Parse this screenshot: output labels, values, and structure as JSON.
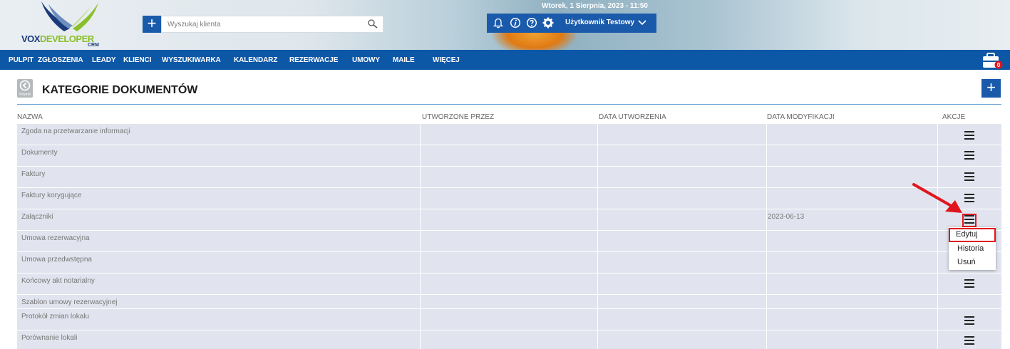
{
  "app": {
    "logo_part1": "VOX",
    "logo_part2": "DEVELOPER",
    "logo_suffix": "CRM",
    "date": "Wtorek, 1 Sierpnia, 2023 - 11:50",
    "user_name": "Użytkownik Testowy"
  },
  "search": {
    "placeholder": "Wyszukaj klienta"
  },
  "nav": {
    "items": [
      "PULPIT",
      "ZGŁOSZENIA",
      "LEADY",
      "KLIENCI",
      "WYSZUKIWARKA",
      "KALENDARZ",
      "REZERWACJE",
      "UMOWY",
      "MAILE",
      "WIĘCEJ"
    ],
    "briefcase_badge": "0"
  },
  "page": {
    "back_label": "Powrót",
    "title": "KATEGORIE DOKUMENTÓW",
    "add_label": "+"
  },
  "table": {
    "headers": [
      "NAZWA",
      "UTWORZONE PRZEZ",
      "DATA UTWORZENIA",
      "DATA MODYFIKACJI",
      "AKCJE"
    ],
    "rows": [
      {
        "name": "Zgoda na przetwarzanie informacji",
        "created_by": "",
        "created": "",
        "modified": "",
        "has_menu": true
      },
      {
        "name": "Dokumenty",
        "created_by": "",
        "created": "",
        "modified": "",
        "has_menu": true
      },
      {
        "name": "Faktury",
        "created_by": "",
        "created": "",
        "modified": "",
        "has_menu": true
      },
      {
        "name": "Faktury korygujące",
        "created_by": "",
        "created": "",
        "modified": "",
        "has_menu": true
      },
      {
        "name": "Załączniki",
        "created_by": "",
        "created": "",
        "modified": "2023-06-13",
        "has_menu": true
      },
      {
        "name": "Umowa rezerwacyjna",
        "created_by": "",
        "created": "",
        "modified": "",
        "has_menu": false
      },
      {
        "name": "Umowa przedwstępna",
        "created_by": "",
        "created": "",
        "modified": "",
        "has_menu": false
      },
      {
        "name": "Końcowy akt notarialny",
        "created_by": "",
        "created": "",
        "modified": "",
        "has_menu": true
      },
      {
        "name": "Szablon umowy rezerwacyjnej",
        "created_by": "",
        "created": "",
        "modified": "",
        "has_menu": false
      },
      {
        "name": "Protokół zmian lokalu",
        "created_by": "",
        "created": "",
        "modified": "",
        "has_menu": true
      },
      {
        "name": "Porównanie lokali",
        "created_by": "",
        "created": "",
        "modified": "",
        "has_menu": true
      }
    ]
  },
  "row_menu": {
    "items": [
      "Edytuj",
      "Historia",
      "Usuń"
    ]
  },
  "colors": {
    "primary": "#1a5aab",
    "nav": "#0d57a7",
    "row_bg": "#e1e4ee",
    "highlight": "#e0161e"
  }
}
